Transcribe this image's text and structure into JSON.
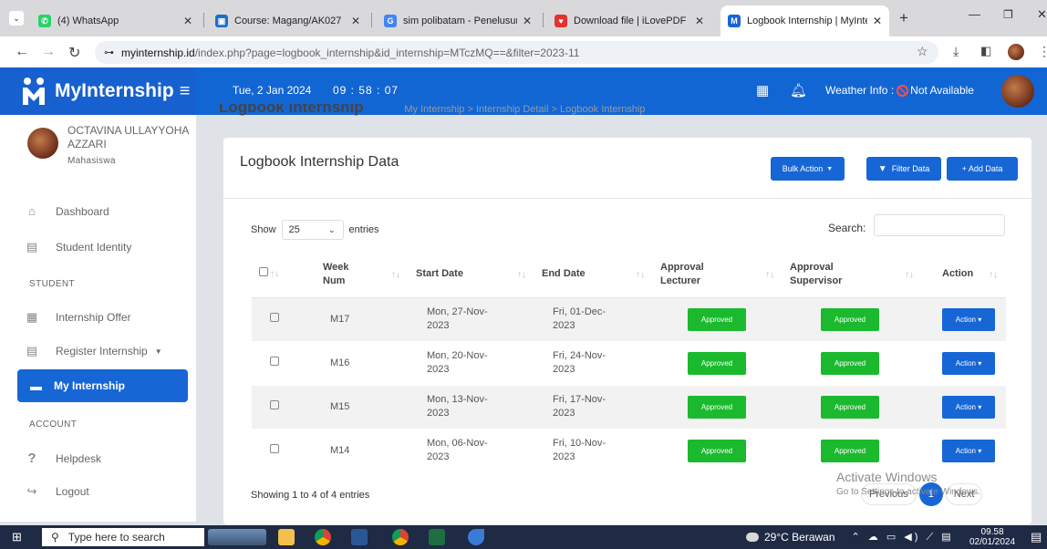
{
  "browser": {
    "tabs": [
      {
        "title": "(4) WhatsApp",
        "fav_color": "#25d366",
        "fav_glyph": "✆",
        "active": false
      },
      {
        "title": "Course: Magang/AK027",
        "fav_color": "#1f6fc5",
        "fav_glyph": "▣",
        "active": false
      },
      {
        "title": "sim polibatam - Penelusuran",
        "fav_color": "#4285f4",
        "fav_glyph": "G",
        "active": false
      },
      {
        "title": "Download file | iLovePDF",
        "fav_color": "#e5322d",
        "fav_glyph": "♥",
        "active": false
      },
      {
        "title": "Logbook Internship | MyInte",
        "fav_color": "#1766d6",
        "fav_glyph": "M",
        "active": true
      }
    ],
    "new_tab": "+",
    "url_host": "myinternship.id",
    "url_path": "/index.php?page=logbook_internship&id_internship=MTczMQ==&filter=2023-11"
  },
  "header": {
    "brand": "MyInternship",
    "menu_glyph": "≡",
    "date": "Tue, 2 Jan 2024",
    "time": "09 : 58 : 07",
    "weather_label": "Weather Info :",
    "weather_value": "Not Available"
  },
  "breadcrumb": {
    "title": "Logbook Internship",
    "trail": "My Internship  >  Internship Detail  >  Logbook Internship"
  },
  "sidebar": {
    "user_name": "OCTAVINA ULLAYYOHA AZZARI",
    "user_role": "Mahasiswa",
    "items": [
      {
        "label": "Dashboard",
        "icon": "home-icon",
        "glyph": "⌂"
      },
      {
        "label": "Student Identity",
        "icon": "id-card-icon",
        "glyph": "▤"
      }
    ],
    "student_heading": "STUDENT",
    "student_items": [
      {
        "label": "Internship Offer",
        "icon": "building-icon",
        "glyph": "▦"
      },
      {
        "label": "Register Internship",
        "icon": "register-icon",
        "glyph": "▤"
      }
    ],
    "active_item": {
      "label": "My Internship",
      "glyph": "▬"
    },
    "account_heading": "ACCOUNT",
    "account_items": [
      {
        "label": "Helpdesk",
        "icon": "question-icon",
        "glyph": "?"
      },
      {
        "label": "Logout",
        "icon": "logout-icon",
        "glyph": "↪"
      }
    ]
  },
  "card": {
    "title": "Logbook Internship Data",
    "bulk_action": "Bulk Action",
    "filter_data": "Filter Data",
    "add_data": "+ Add Data",
    "show_label": "Show",
    "entries_value": "25",
    "entries_label": "entries",
    "search_label": "Search:",
    "search_value": ""
  },
  "table": {
    "headers": [
      "Week Num",
      "Start Date",
      "End Date",
      "Approval Lecturer",
      "Approval Supervisor",
      "Action"
    ],
    "rows": [
      {
        "week": "M17",
        "start": "Mon, 27-Nov-2023",
        "end": "Fri, 01-Dec-2023",
        "lecturer": "Approved",
        "supervisor": "Approved",
        "action": "Action"
      },
      {
        "week": "M16",
        "start": "Mon, 20-Nov-2023",
        "end": "Fri, 24-Nov-2023",
        "lecturer": "Approved",
        "supervisor": "Approved",
        "action": "Action"
      },
      {
        "week": "M15",
        "start": "Mon, 13-Nov-2023",
        "end": "Fri, 17-Nov-2023",
        "lecturer": "Approved",
        "supervisor": "Approved",
        "action": "Action"
      },
      {
        "week": "M14",
        "start": "Mon, 06-Nov-2023",
        "end": "Fri, 10-Nov-2023",
        "lecturer": "Approved",
        "supervisor": "Approved",
        "action": "Action"
      }
    ]
  },
  "footer": {
    "showing": "Showing 1 to 4 of 4 entries",
    "previous": "Previous",
    "page": "1",
    "next": "Next"
  },
  "watermark": {
    "line1": "Activate Windows",
    "line2": "Go to Settings to activate Windows."
  },
  "taskbar": {
    "search_placeholder": "Type here to search",
    "weather": "29°C  Berawan",
    "time": "09.58",
    "date": "02/01/2024"
  },
  "colors": {
    "primary": "#1766d6",
    "approved": "#1bb92e"
  }
}
